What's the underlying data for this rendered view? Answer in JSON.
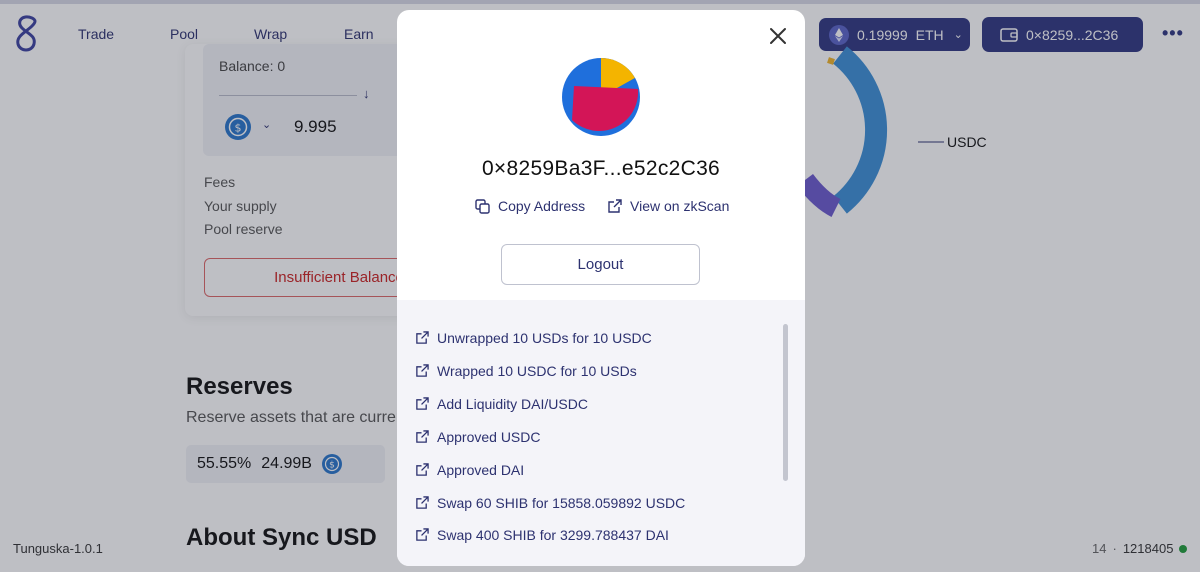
{
  "nav": {
    "items": [
      "Trade",
      "Pool",
      "Wrap",
      "Earn"
    ],
    "eth_balance": "0.19999",
    "eth_symbol": "ETH",
    "wallet_short": "0×8259...2C36"
  },
  "swap": {
    "balance": "Balance: 0",
    "amount": "9.995",
    "labels": [
      "Fees",
      "Your supply",
      "Pool reserve"
    ],
    "insufficient": "Insufficient Balance"
  },
  "reserves": {
    "title": "Reserves",
    "subtitle": "Reserve assets that are currently",
    "percent": "55.55%",
    "amount": "24.99B"
  },
  "about_title": "About Sync USD",
  "chart": {
    "label": "USDC"
  },
  "footer": {
    "version": "Tunguska-1.0.1",
    "count": "14",
    "sep": "·",
    "block": "1218405"
  },
  "modal": {
    "address": "0×8259Ba3F...e52c2C36",
    "copy_label": "Copy Address",
    "view_label": "View on zkScan",
    "logout_label": "Logout",
    "transactions": [
      "Unwrapped 10 USDs for 10 USDC",
      "Wrapped 10 USDC for 10 USDs",
      "Add Liquidity DAI/USDC",
      "Approved USDC",
      "Approved DAI",
      "Swap 60 SHIB for 15858.059892 USDC",
      "Swap 400 SHIB for 3299.788437 DAI"
    ]
  },
  "colors": {
    "accent": "#2f3580",
    "link": "#2d3270",
    "error": "#cc2222",
    "status_ok": "#1f9d3a"
  }
}
